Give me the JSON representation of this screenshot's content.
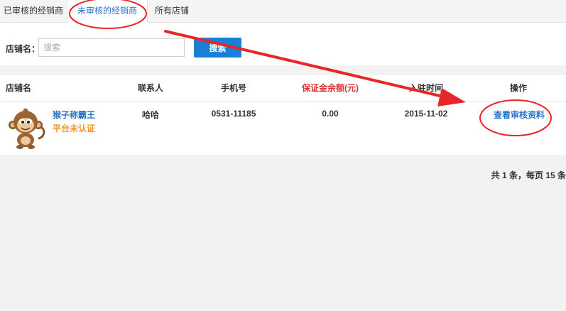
{
  "tabs": [
    {
      "label": "已审核的经销商",
      "active": false
    },
    {
      "label": "未审核的经销商",
      "active": true
    },
    {
      "label": "所有店铺",
      "active": false
    }
  ],
  "search": {
    "label": "店铺名：",
    "placeholder": "搜索",
    "value": "",
    "button_label": "搜索"
  },
  "table": {
    "headers": [
      "店铺名",
      "联系人",
      "手机号",
      "保证金余额(元)",
      "入驻时间",
      "操作"
    ],
    "rows": [
      {
        "store_name": "猴子称霸王",
        "status": "平台未认证",
        "contact": "哈哈",
        "phone": "0531-11185",
        "deposit": "0.00",
        "join_date": "2015-11-02",
        "action": "查看审核资料"
      }
    ]
  },
  "pagination": {
    "text": "共 1 条，每页 15 条"
  },
  "colors": {
    "accent_blue": "#2b73c9",
    "button_blue": "#1b7fd6",
    "header_red": "#e23434",
    "status_orange": "#f0962b",
    "annotation_red": "#e8262a"
  }
}
